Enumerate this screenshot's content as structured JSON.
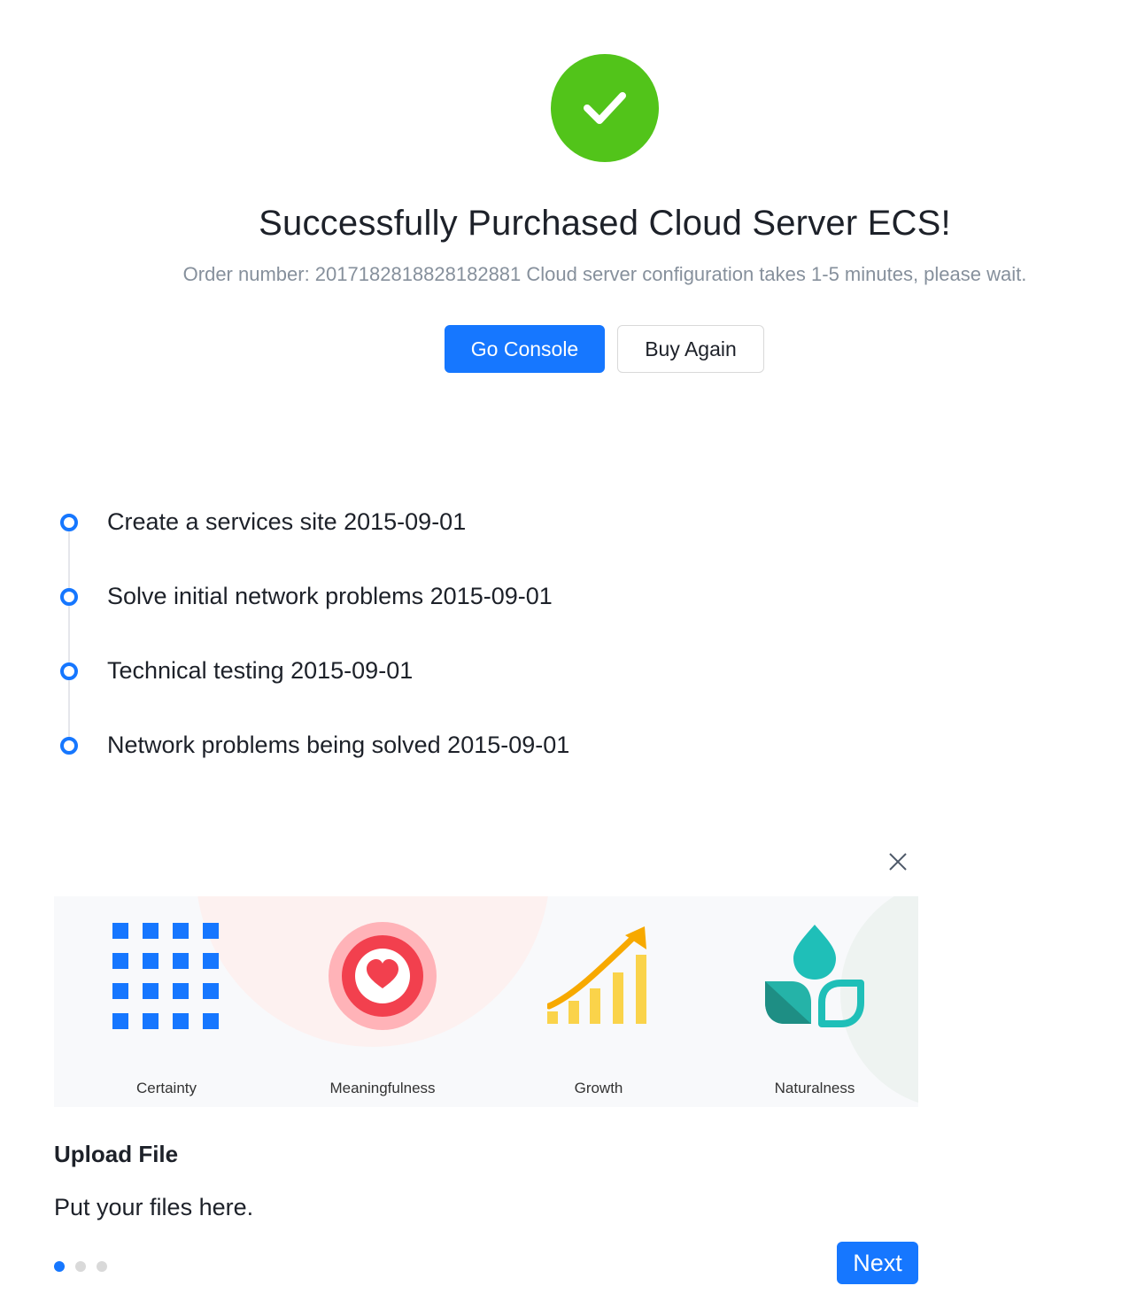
{
  "result": {
    "icon": "check-circle-icon",
    "status_color": "#52c41a",
    "title": "Successfully Purchased Cloud Server ECS!",
    "subtitle": "Order number: 2017182818828182881 Cloud server configuration takes 1-5 minutes, please wait.",
    "primary_button": "Go Console",
    "secondary_button": "Buy Again"
  },
  "timeline": {
    "items": [
      {
        "label": "Create a services site 2015-09-01"
      },
      {
        "label": "Solve initial network problems 2015-09-01"
      },
      {
        "label": "Technical testing 2015-09-01"
      },
      {
        "label": "Network problems being solved 2015-09-01"
      }
    ]
  },
  "tour": {
    "close_icon": "close-icon",
    "cover": {
      "items": [
        {
          "label": "Certainty",
          "icon": "grid-squares-icon"
        },
        {
          "label": "Meaningfulness",
          "icon": "heart-target-icon"
        },
        {
          "label": "Growth",
          "icon": "growth-bars-icon"
        },
        {
          "label": "Naturalness",
          "icon": "leaf-icon"
        }
      ]
    },
    "title": "Upload File",
    "description": "Put your files here.",
    "steps_total": 3,
    "current_step": 1,
    "next_button": "Next",
    "accent_color": "#1677ff"
  }
}
